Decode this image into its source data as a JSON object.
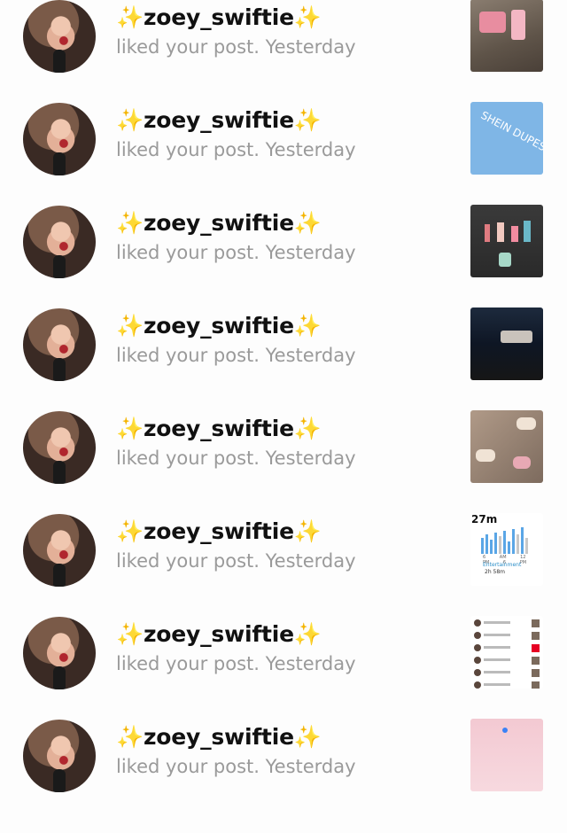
{
  "activity": {
    "rows": [
      {
        "name": "✨zoey_swiftie✨",
        "sparkle_left": "✨",
        "username": "zoey_swiftie",
        "sparkle_right": "✨",
        "text": "liked your post. Yesterday",
        "thumb": "cosmetics-photo"
      },
      {
        "name": "✨zoey_swiftie✨",
        "sparkle_left": "✨",
        "username": "zoey_swiftie",
        "sparkle_right": "✨",
        "text": "liked your post. Yesterday",
        "thumb": "shein-dupes",
        "thumb_text": "SHEIN DUPES"
      },
      {
        "name": "✨zoey_swiftie✨",
        "sparkle_left": "✨",
        "username": "zoey_swiftie",
        "sparkle_right": "✨",
        "text": "liked your post. Yesterday",
        "thumb": "products-shelf"
      },
      {
        "name": "✨zoey_swiftie✨",
        "sparkle_left": "✨",
        "username": "zoey_swiftie",
        "sparkle_right": "✨",
        "text": "liked your post. Yesterday",
        "thumb": "car-mirror"
      },
      {
        "name": "✨zoey_swiftie✨",
        "sparkle_left": "✨",
        "username": "zoey_swiftie",
        "sparkle_right": "✨",
        "text": "liked your post. Yesterday",
        "thumb": "feet-circle"
      },
      {
        "name": "✨zoey_swiftie✨",
        "sparkle_left": "✨",
        "username": "zoey_swiftie",
        "sparkle_right": "✨",
        "text": "liked your post. Yesterday",
        "thumb": "screen-time",
        "thumb_text": "27m",
        "thumb_caption": "Entertainment",
        "thumb_caption2": "2h 58m",
        "thumb_ticks": "6 AM 12 PM 6 PM"
      },
      {
        "name": "✨zoey_swiftie✨",
        "sparkle_left": "✨",
        "username": "zoey_swiftie",
        "sparkle_right": "✨",
        "text": "liked your post. Yesterday",
        "thumb": "notifications-list"
      },
      {
        "name": "✨zoey_swiftie✨",
        "sparkle_left": "✨",
        "username": "zoey_swiftie",
        "sparkle_right": "✨",
        "text": "liked your post. Yesterday",
        "thumb": "pink-post"
      }
    ]
  },
  "colors": {
    "name": "#111111",
    "sub": "#9a9a9a",
    "sparkle": "#f4c430",
    "background": "#fdfdfd"
  }
}
